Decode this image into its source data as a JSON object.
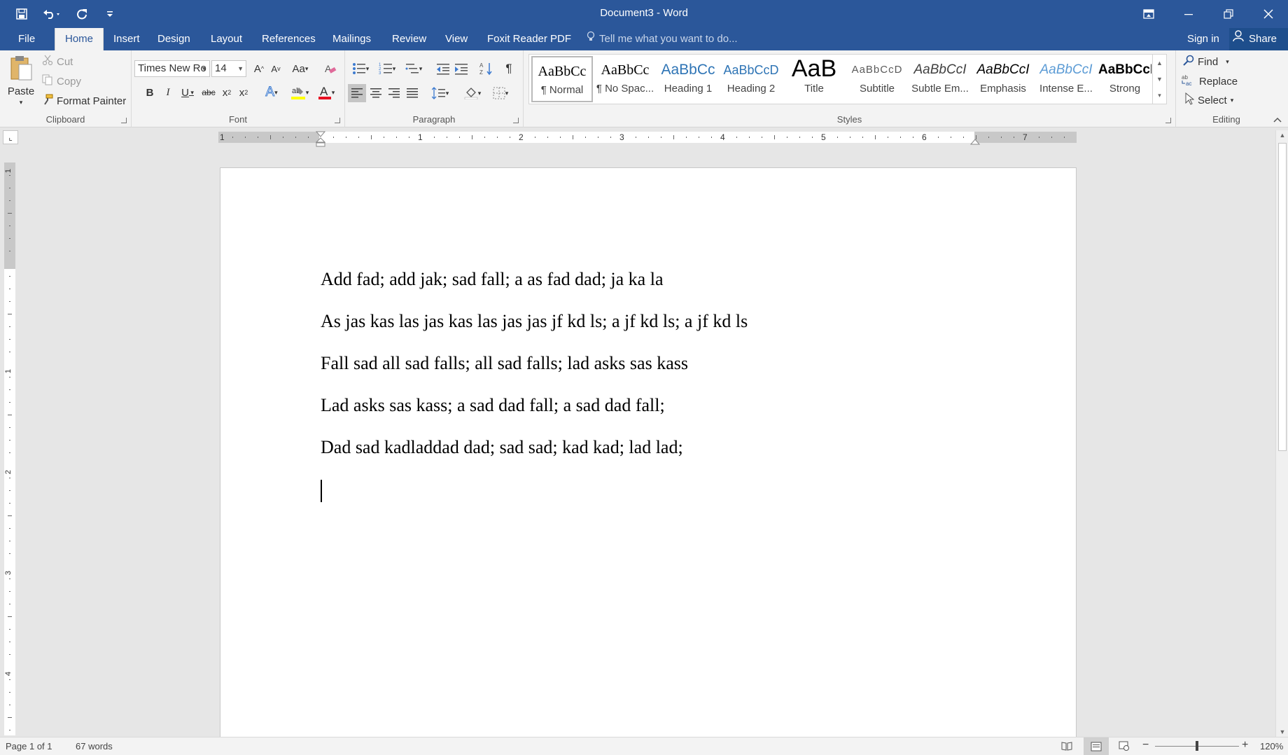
{
  "window": {
    "title": "Document3 - Word"
  },
  "tabs": [
    {
      "label": "File",
      "active": false
    },
    {
      "label": "Home",
      "active": true
    },
    {
      "label": "Insert",
      "active": false
    },
    {
      "label": "Design",
      "active": false
    },
    {
      "label": "Layout",
      "active": false
    },
    {
      "label": "References",
      "active": false
    },
    {
      "label": "Mailings",
      "active": false
    },
    {
      "label": "Review",
      "active": false
    },
    {
      "label": "View",
      "active": false
    },
    {
      "label": "Foxit Reader PDF",
      "active": false
    }
  ],
  "tellme": {
    "placeholder": "Tell me what you want to do..."
  },
  "account": {
    "signin": "Sign in",
    "share": "Share"
  },
  "clipboard": {
    "label": "Clipboard",
    "paste": "Paste",
    "cut": "Cut",
    "copy": "Copy",
    "format_painter": "Format Painter"
  },
  "font": {
    "label": "Font",
    "name": "Times New Ro",
    "size": "14",
    "change_case": "Aa"
  },
  "paragraph": {
    "label": "Paragraph"
  },
  "styles": {
    "label": "Styles",
    "items": [
      {
        "preview": "AaBbCc",
        "name": "¶ Normal",
        "selected": true
      },
      {
        "preview": "AaBbCc",
        "name": "¶ No Spac...",
        "selected": false
      },
      {
        "preview": "AaBbCc",
        "name": "Heading 1",
        "selected": false
      },
      {
        "preview": "AaBbCcD",
        "name": "Heading 2",
        "selected": false
      },
      {
        "preview": "AaB",
        "name": "Title",
        "selected": false
      },
      {
        "preview": "AaBbCcD",
        "name": "Subtitle",
        "selected": false
      },
      {
        "preview": "AaBbCcI",
        "name": "Subtle Em...",
        "selected": false
      },
      {
        "preview": "AaBbCcI",
        "name": "Emphasis",
        "selected": false
      },
      {
        "preview": "AaBbCcI",
        "name": "Intense E...",
        "selected": false
      },
      {
        "preview": "AaBbCcI",
        "name": "Strong",
        "selected": false
      }
    ]
  },
  "editing": {
    "label": "Editing",
    "find": "Find",
    "replace": "Replace",
    "select": "Select"
  },
  "ruler": {
    "numbers": [
      "1",
      "1",
      "2",
      "3",
      "4",
      "5",
      "6",
      "7"
    ]
  },
  "vruler": {
    "numbers": [
      "1",
      "1",
      "2",
      "3",
      "4"
    ]
  },
  "document": {
    "lines": [
      "Add fad; add jak; sad fall; a as fad dad; ja ka la",
      "As jas kas las jas kas las jas jas jf kd ls; a jf kd ls; a jf kd ls",
      "Fall sad all sad falls; all sad falls; lad asks sas kass",
      "Lad asks sas kass; a sad dad fall; a sad dad fall;",
      "Dad sad kadladdad dad; sad sad; kad kad; lad lad;"
    ]
  },
  "status": {
    "page": "Page 1 of 1",
    "words": "67 words",
    "zoom": "120%",
    "zoom_value": 120
  },
  "colors": {
    "brand": "#2b579a",
    "font_color": "#e81123",
    "highlight": "#ffff00"
  }
}
